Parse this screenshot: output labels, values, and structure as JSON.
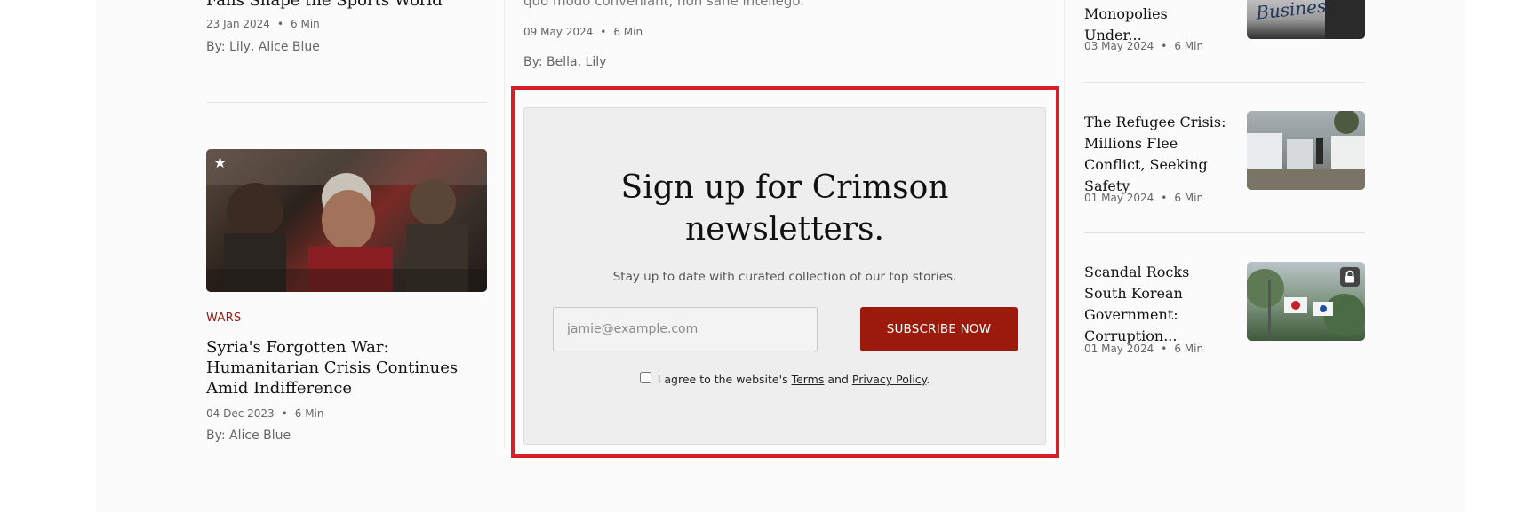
{
  "left_column": {
    "top_article": {
      "title": "Fans Shape the Sports World",
      "date": "23 Jan 2024",
      "read_time": "6 Min",
      "authors": "By: Lily, Alice Blue"
    },
    "article": {
      "category": "WARS",
      "title": "Syria's Forgotten War: Humanitarian Crisis Continues Amid Indifference",
      "date": "04 Dec 2023",
      "read_time": "6 Min",
      "authors": "By: Alice Blue",
      "badge_icon": "star-icon"
    }
  },
  "center_column": {
    "top_article": {
      "excerpt": "quo modo conveniant, non sane intellego.",
      "date": "09 May 2024",
      "read_time": "6 Min",
      "authors": "By: Bella, Lily"
    },
    "newsletter": {
      "title": "Sign up for Crimson newsletters.",
      "subtitle": "Stay up to date with curated collection of our top stories.",
      "email_placeholder": "jamie@example.com",
      "button_label": "SUBSCRIBE NOW",
      "agree_prefix": "I agree to the website's",
      "terms_label": "Terms",
      "and_label": "and",
      "privacy_label": "Privacy Policy",
      "agree_suffix": "."
    }
  },
  "right_column": {
    "items": [
      {
        "title": "Monopolies Under...",
        "date": "03 May 2024",
        "read_time": "6 Min",
        "thumb_text": "Business"
      },
      {
        "title": "The Refugee Crisis: Millions Flee Conflict, Seeking Safety",
        "date": "01 May 2024",
        "read_time": "6 Min"
      },
      {
        "title": "Scandal Rocks South Korean Government: Corruption...",
        "date": "01 May 2024",
        "read_time": "6 Min",
        "badge_icon": "lock-icon"
      }
    ]
  },
  "meta_separator": "•",
  "colors": {
    "accent": "#9b1a0c",
    "highlight": "#d61f26",
    "category": "#9b1a10"
  }
}
